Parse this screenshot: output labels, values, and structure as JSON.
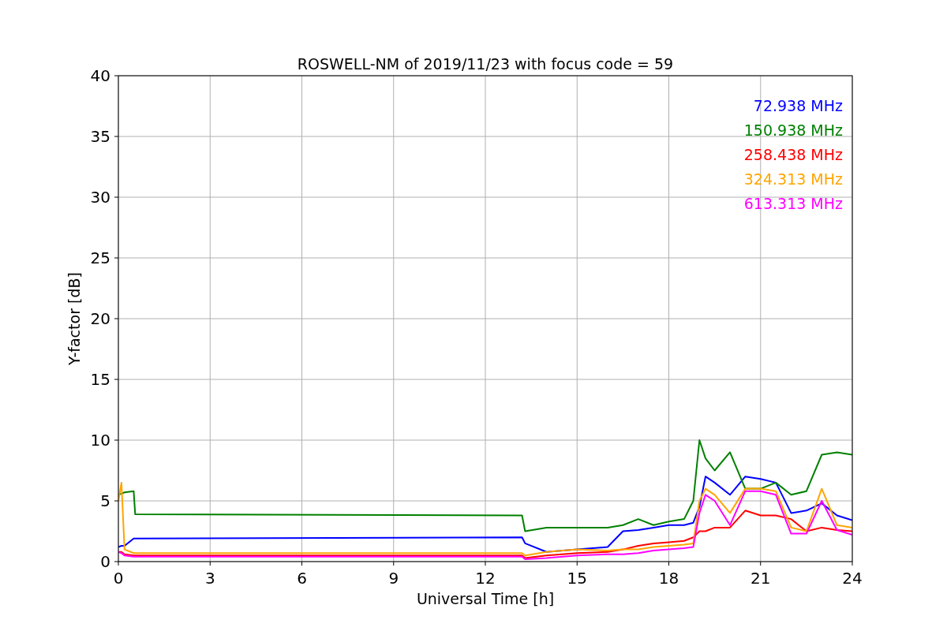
{
  "figure": {
    "chart_data": {
      "type": "line",
      "title": "ROSWELL-NM of 2019/11/23 with focus code = 59",
      "xlabel": "Universal Time [h]",
      "ylabel": "Y-factor [dB]",
      "x": [
        0,
        0.1,
        0.2,
        0.5,
        0.55,
        13.2,
        13.3,
        14,
        15,
        16,
        16.5,
        17,
        17.5,
        18,
        18.5,
        18.8,
        19,
        19.2,
        19.5,
        20,
        20.5,
        21,
        21.5,
        22,
        22.5,
        23,
        23.5,
        24
      ],
      "series": [
        {
          "name": "72.938 MHz",
          "color": "#0000ff",
          "values": [
            1.2,
            1.3,
            1.3,
            1.9,
            1.9,
            2.0,
            1.5,
            0.8,
            1.0,
            1.2,
            2.5,
            2.6,
            2.8,
            3.0,
            3.0,
            3.2,
            4.5,
            7.0,
            6.5,
            5.5,
            7.0,
            6.8,
            6.5,
            4.0,
            4.2,
            4.8,
            3.8,
            3.4
          ]
        },
        {
          "name": "150.938 MHz",
          "color": "#008000",
          "values": [
            5.5,
            5.6,
            5.7,
            5.8,
            3.9,
            3.8,
            2.5,
            2.8,
            2.8,
            2.8,
            3.0,
            3.5,
            3.0,
            3.3,
            3.5,
            5.0,
            10.0,
            8.5,
            7.5,
            9.0,
            6.0,
            6.0,
            6.5,
            5.5,
            5.8,
            8.8,
            9.0,
            8.8
          ]
        },
        {
          "name": "258.438 MHz",
          "color": "#ff0000",
          "values": [
            0.8,
            0.8,
            0.6,
            0.5,
            0.5,
            0.5,
            0.3,
            0.5,
            0.7,
            0.8,
            1.0,
            1.3,
            1.5,
            1.6,
            1.7,
            2.0,
            2.5,
            2.5,
            2.8,
            2.8,
            4.2,
            3.8,
            3.8,
            3.5,
            2.5,
            2.8,
            2.6,
            2.5
          ]
        },
        {
          "name": "324.313 MHz",
          "color": "#ffa500",
          "values": [
            5.0,
            6.5,
            1.0,
            0.7,
            0.7,
            0.7,
            0.5,
            0.8,
            1.0,
            0.9,
            1.0,
            1.0,
            1.2,
            1.3,
            1.4,
            1.5,
            5.0,
            6.0,
            5.5,
            4.0,
            6.0,
            6.0,
            5.8,
            2.8,
            2.5,
            6.0,
            3.0,
            2.8
          ]
        },
        {
          "name": "613.313 MHz",
          "color": "#ff00ff",
          "values": [
            0.8,
            0.7,
            0.5,
            0.4,
            0.4,
            0.4,
            0.2,
            0.3,
            0.5,
            0.6,
            0.6,
            0.7,
            0.9,
            1.0,
            1.1,
            1.2,
            4.0,
            5.5,
            5.0,
            3.0,
            5.8,
            5.8,
            5.5,
            2.3,
            2.3,
            5.0,
            2.6,
            2.2
          ]
        }
      ],
      "grid": true,
      "xlim": [
        0,
        24
      ],
      "ylim": [
        0,
        40
      ],
      "xticks": [
        0,
        3,
        6,
        9,
        12,
        15,
        18,
        21,
        24
      ],
      "yticks": [
        0,
        5,
        10,
        15,
        20,
        25,
        30,
        35,
        40
      ]
    }
  }
}
